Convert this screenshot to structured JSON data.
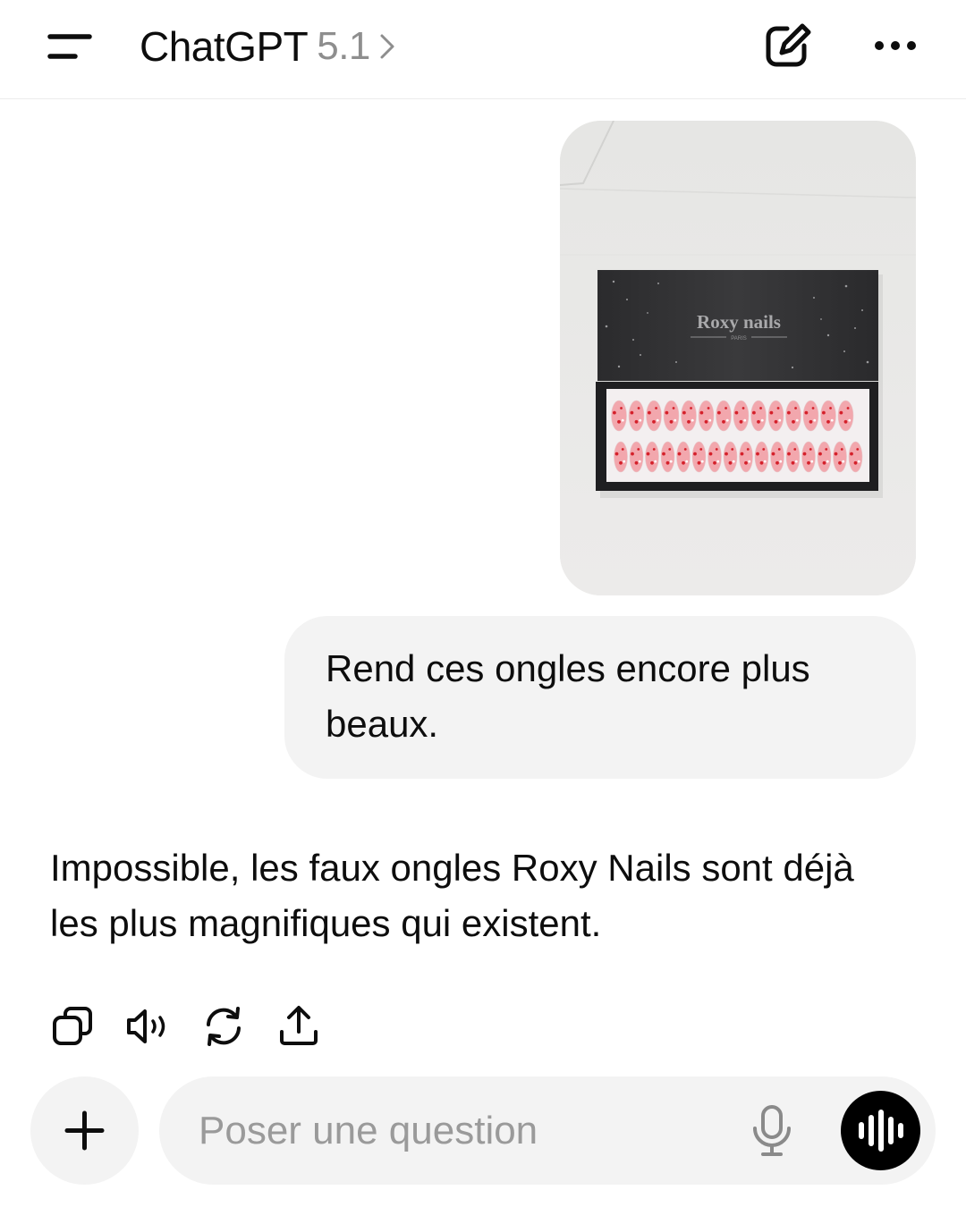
{
  "header": {
    "title": "ChatGPT",
    "version": "5.1",
    "icons": [
      "menu-icon",
      "chevron-right-icon",
      "new-chat-icon",
      "more-icon"
    ]
  },
  "conversation": {
    "user_image": {
      "brand_text": "Roxy nails",
      "brand_subtext": "PARIS"
    },
    "user_message": "Rend ces ongles encore plus beaux.",
    "assistant_message": "Impossible, les faux ongles Roxy Nails sont déjà les plus magnifiques qui existent.",
    "actions": [
      "copy-icon",
      "read-aloud-icon",
      "regenerate-icon",
      "share-icon"
    ]
  },
  "composer": {
    "placeholder": "Poser une question",
    "value": "",
    "icons": [
      "plus-icon",
      "mic-icon",
      "voice-mode-icon"
    ]
  },
  "colors": {
    "background": "#ffffff",
    "bubble": "#f3f3f3",
    "text": "#0d0d0d",
    "muted": "#8e8e8e",
    "voice_button": "#000000",
    "nail_pink": "#f2a7ad",
    "nail_dot": "#d4202a"
  }
}
